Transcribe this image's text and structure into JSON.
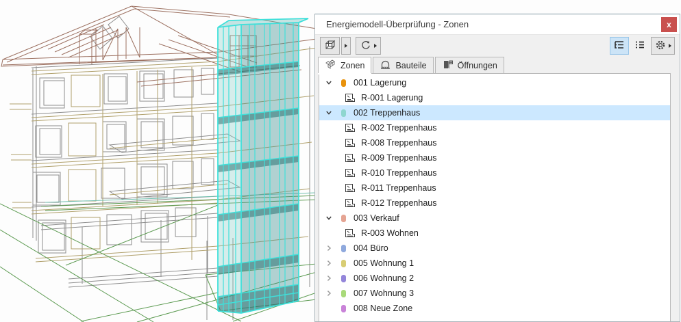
{
  "window": {
    "title": "Energiemodell-Überprüfung - Zonen",
    "close_label": "x"
  },
  "toolbar": {
    "show_in_3d": {
      "icon": "cube-3d-icon",
      "has_dropdown": true
    },
    "update": {
      "icon": "refresh-icon",
      "has_dropdown": true
    },
    "view_toggles": [
      {
        "name": "tree-view",
        "icon": "tree-view-icon",
        "active": true
      },
      {
        "name": "flat-view",
        "icon": "flat-list-icon",
        "active": false
      }
    ],
    "settings": {
      "icon": "gear-icon",
      "has_dropdown": true
    }
  },
  "tabs": [
    {
      "label": "Zonen",
      "icon": "zones-cubes-icon",
      "active": true
    },
    {
      "label": "Bauteile",
      "icon": "building-element-icon",
      "active": false
    },
    {
      "label": "Öffnungen",
      "icon": "door-opening-icon",
      "active": false
    }
  ],
  "tree": {
    "zones": [
      {
        "label": "001 Lagerung",
        "color": "#e8920c",
        "state": "expanded",
        "selected": false,
        "rooms": [
          "R-001 Lagerung"
        ]
      },
      {
        "label": "002 Treppenhaus",
        "color": "#8fd6cf",
        "state": "expanded",
        "selected": true,
        "rooms": [
          "R-002 Treppenhaus",
          "R-008 Treppenhaus",
          "R-009 Treppenhaus",
          "R-010 Treppenhaus",
          "R-011 Treppenhaus",
          "R-012 Treppenhaus"
        ]
      },
      {
        "label": "003 Verkauf",
        "color": "#e5a493",
        "state": "expanded",
        "selected": false,
        "rooms": [
          "R-003 Wohnen"
        ]
      },
      {
        "label": "004 Büro",
        "color": "#8fa9dd",
        "state": "collapsed",
        "selected": false,
        "rooms": []
      },
      {
        "label": "005 Wohnung 1",
        "color": "#d8cd74",
        "state": "collapsed",
        "selected": false,
        "rooms": []
      },
      {
        "label": "006 Wohnung 2",
        "color": "#9486da",
        "state": "collapsed",
        "selected": false,
        "rooms": []
      },
      {
        "label": "007 Wohnung 3",
        "color": "#a9da7a",
        "state": "collapsed",
        "selected": false,
        "rooms": []
      },
      {
        "label": "008 Neue Zone",
        "color": "#c983d8",
        "state": "leaf",
        "selected": false,
        "rooms": []
      }
    ]
  },
  "colors": {
    "selection_row": "#cce8ff",
    "selected_zone_highlight": "#3fe0da",
    "close_button": "#c9504e",
    "toggle_active_bg": "#cce4f7",
    "toggle_active_border": "#98c5e8"
  }
}
